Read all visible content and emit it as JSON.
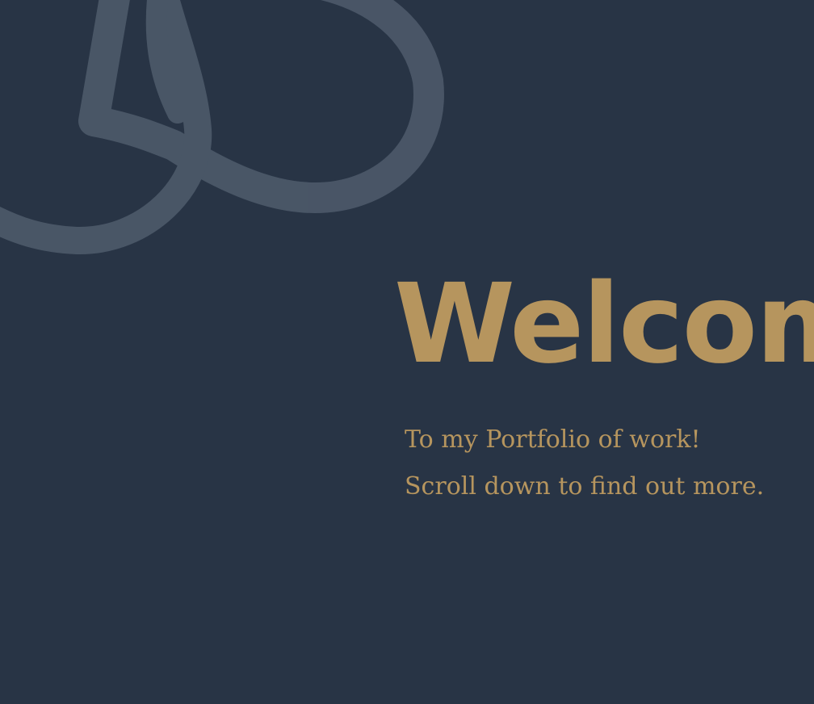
{
  "colors": {
    "background": "#283445",
    "accent": "#b6955e",
    "logo_watermark": "#5e6b7b"
  },
  "logo": {
    "icon": "monogram-watermark-icon"
  },
  "hero": {
    "title": "Welcome",
    "line1": "To my Portfolio of work!",
    "line2": "Scroll down to find out more."
  }
}
